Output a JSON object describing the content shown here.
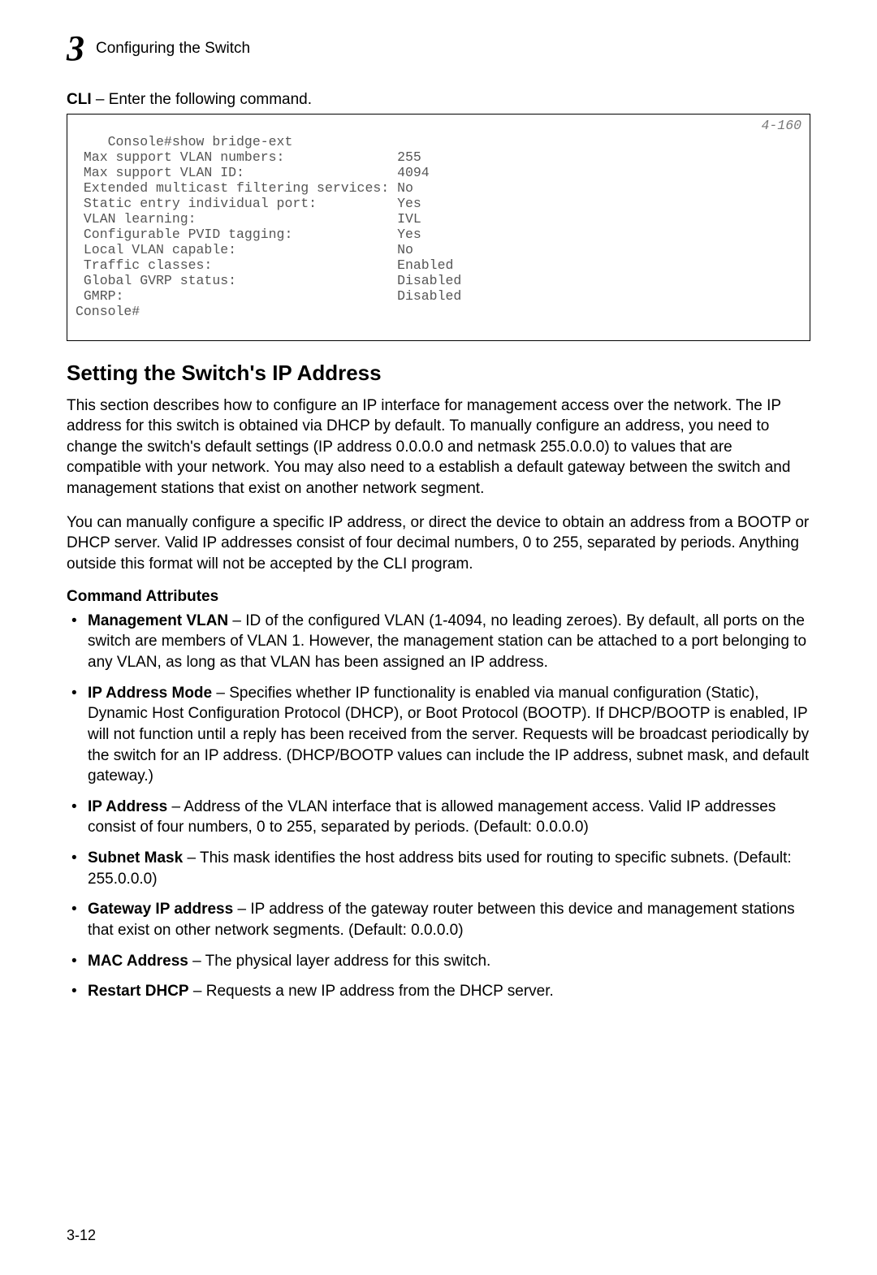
{
  "running_head": {
    "chapter_number": "3",
    "title": "Configuring the Switch"
  },
  "cli_intro": {
    "bold": "CLI",
    "rest": " – Enter the following command."
  },
  "code_block": {
    "page_ref": "4-160",
    "text": "Console#show bridge-ext\n Max support VLAN numbers:              255\n Max support VLAN ID:                   4094\n Extended multicast filtering services: No\n Static entry individual port:          Yes\n VLAN learning:                         IVL\n Configurable PVID tagging:             Yes\n Local VLAN capable:                    No\n Traffic classes:                       Enabled\n Global GVRP status:                    Disabled\n GMRP:                                  Disabled\nConsole#"
  },
  "section_heading": "Setting the Switch's IP Address",
  "paragraphs": [
    "This section describes how to configure an IP interface for management access over the network. The IP address for this switch is obtained via DHCP by default. To manually configure an address, you need to change the switch's default settings (IP address 0.0.0.0 and netmask 255.0.0.0) to values that are compatible with your network. You may also need to a establish a default gateway between the switch and management stations that exist on another network segment.",
    "You can manually configure a specific IP address, or direct the device to obtain an address from a BOOTP or DHCP server. Valid IP addresses consist of four decimal numbers, 0 to 255, separated by periods. Anything outside this format will not be accepted by the CLI program."
  ],
  "command_attributes_heading": "Command Attributes",
  "attributes": [
    {
      "name": "Management VLAN",
      "text": " – ID of the configured VLAN (1-4094, no leading zeroes). By default, all ports on the switch are members of VLAN 1. However, the management station can be attached to a port belonging to any VLAN, as long as that VLAN has been assigned an IP address."
    },
    {
      "name": "IP Address Mode",
      "text": " – Specifies whether IP functionality is enabled via manual configuration (Static), Dynamic Host Configuration Protocol (DHCP), or Boot Protocol (BOOTP). If DHCP/BOOTP is enabled, IP will not function until a reply has been received from the server. Requests will be broadcast periodically by the switch for an IP address. (DHCP/BOOTP values can include the IP address, subnet mask, and default gateway.)"
    },
    {
      "name": "IP Address",
      "text": " – Address of the VLAN interface that is allowed management access. Valid IP addresses consist of four numbers, 0 to 255, separated by periods. (Default: 0.0.0.0)"
    },
    {
      "name": "Subnet Mask",
      "text": " – This mask identifies the host address bits used for routing to specific subnets. (Default: 255.0.0.0)"
    },
    {
      "name": "Gateway IP address",
      "text": " – IP address of the gateway router between this device and management stations that exist on other network segments. (Default: 0.0.0.0)"
    },
    {
      "name": "MAC Address",
      "text": " – The physical layer address for this switch."
    },
    {
      "name": "Restart DHCP",
      "text": " – Requests a new IP address from the DHCP server."
    }
  ],
  "page_number": "3-12"
}
